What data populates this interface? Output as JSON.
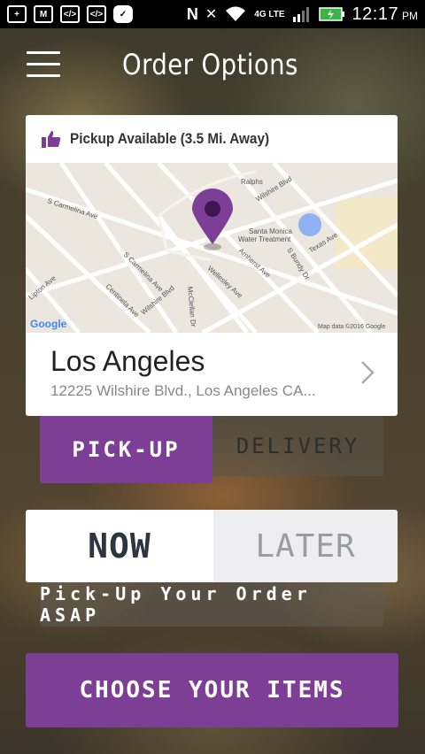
{
  "status_bar": {
    "time": "12:17",
    "ampm": "PM",
    "network": "4G LTE"
  },
  "header": {
    "title": "Order Options"
  },
  "location_card": {
    "availability": "Pickup Available (3.5 Mi. Away)",
    "city": "Los Angeles",
    "address": "12225 Wilshire Blvd., Los Angeles CA...",
    "map": {
      "labels": {
        "ralphs": "Ralphs",
        "wilshire_top": "Wilshire Blvd",
        "s_carmelina_ave": "S Carmelina Ave",
        "santa_monica_1": "Santa Monica",
        "santa_monica_2": "Water Treatment",
        "texas_ave": "Texas Ave",
        "s_bundy_dr": "S Bundy Dr",
        "amherst_ave": "Amherst Ave",
        "s_carmelina_ave_2": "S Carmelina Ave",
        "lipton_ave": "Lipton Ave",
        "centinela_ave": "Centinela Ave",
        "wilshire_bottom": "Wilshire Blvd",
        "mcclellan_dr": "McClellan Dr",
        "wellesley_ave": "Wellesley Ave",
        "google": "Google",
        "map_data": "Map data ©2016 Google"
      }
    }
  },
  "fulfillment": {
    "pickup_label": "PICK-UP",
    "delivery_label": "DELIVERY"
  },
  "timing": {
    "now_label": "NOW",
    "later_label": "LATER",
    "asap_text": "Pick-Up Your Order ASAP"
  },
  "cta": {
    "label": "CHOOSE YOUR ITEMS"
  },
  "colors": {
    "accent": "#7d3e96",
    "status_bar": "#000000"
  }
}
